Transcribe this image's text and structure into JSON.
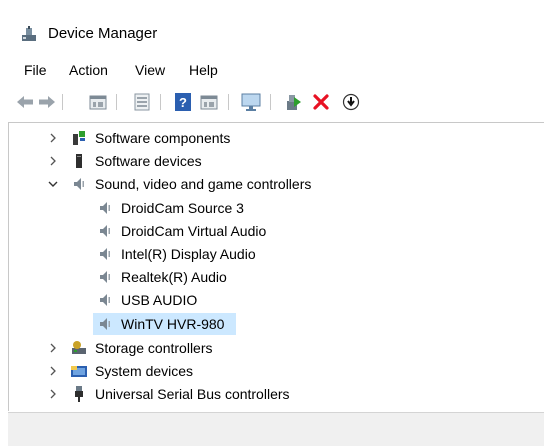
{
  "window": {
    "title": "Device Manager"
  },
  "menu": {
    "file": "File",
    "action": "Action",
    "view": "View",
    "help": "Help"
  },
  "toolbar": {
    "buttons": [
      "back-icon",
      "forward-icon",
      "properties-icon",
      "update-icon",
      "help-icon",
      "view-icon",
      "scan-icon",
      "enable-device-icon",
      "uninstall-icon",
      "disable-device-icon"
    ]
  },
  "tree": {
    "software_components": "Software components",
    "software_devices": "Software devices",
    "sound": {
      "label": "Sound, video and game controllers",
      "children": [
        "DroidCam Source 3",
        "DroidCam Virtual Audio",
        "Intel(R) Display Audio",
        "Realtek(R) Audio",
        "USB AUDIO",
        "WinTV HVR-980"
      ],
      "selected_index": 5
    },
    "storage_controllers": "Storage controllers",
    "system_devices": "System devices",
    "usb_controllers": "Universal Serial Bus controllers"
  },
  "colors": {
    "selection": "#cce8ff",
    "uninstall": "#e81123",
    "enable": "#2e9e2e"
  }
}
